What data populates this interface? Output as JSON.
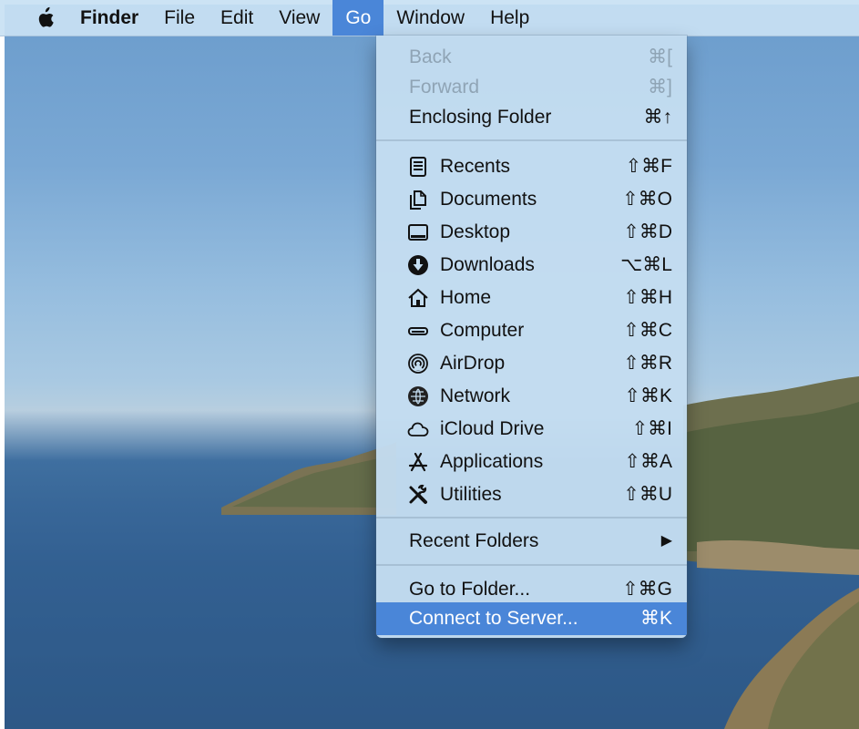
{
  "colors": {
    "highlight": "#4a86d8",
    "menubar_bg": "#c8e1f3",
    "disabled_text": "#8fa4b5"
  },
  "menubar": {
    "apple_icon": "apple-logo-icon",
    "items": [
      "Finder",
      "File",
      "Edit",
      "View",
      "Go",
      "Window",
      "Help"
    ]
  },
  "go_menu": {
    "back": {
      "label": "Back",
      "shortcut": "⌘["
    },
    "forward": {
      "label": "Forward",
      "shortcut": "⌘]"
    },
    "enclosing": {
      "label": "Enclosing Folder",
      "shortcut": "⌘↑"
    },
    "places": [
      {
        "label": "Recents",
        "shortcut": "⇧⌘F",
        "icon": "recents-icon"
      },
      {
        "label": "Documents",
        "shortcut": "⇧⌘O",
        "icon": "documents-icon"
      },
      {
        "label": "Desktop",
        "shortcut": "⇧⌘D",
        "icon": "desktop-icon"
      },
      {
        "label": "Downloads",
        "shortcut": "⌥⌘L",
        "icon": "downloads-icon"
      },
      {
        "label": "Home",
        "shortcut": "⇧⌘H",
        "icon": "home-icon"
      },
      {
        "label": "Computer",
        "shortcut": "⇧⌘C",
        "icon": "computer-icon"
      },
      {
        "label": "AirDrop",
        "shortcut": "⇧⌘R",
        "icon": "airdrop-icon"
      },
      {
        "label": "Network",
        "shortcut": "⇧⌘K",
        "icon": "network-icon"
      },
      {
        "label": "iCloud Drive",
        "shortcut": "⇧⌘I",
        "icon": "icloud-icon"
      },
      {
        "label": "Applications",
        "shortcut": "⇧⌘A",
        "icon": "applications-icon"
      },
      {
        "label": "Utilities",
        "shortcut": "⇧⌘U",
        "icon": "utilities-icon"
      }
    ],
    "recent_folders": {
      "label": "Recent Folders",
      "shortcut": "▶"
    },
    "go_to_folder": {
      "label": "Go to Folder...",
      "shortcut": "⇧⌘G"
    },
    "connect_to_server": {
      "label": "Connect to Server...",
      "shortcut": "⌘K"
    }
  }
}
